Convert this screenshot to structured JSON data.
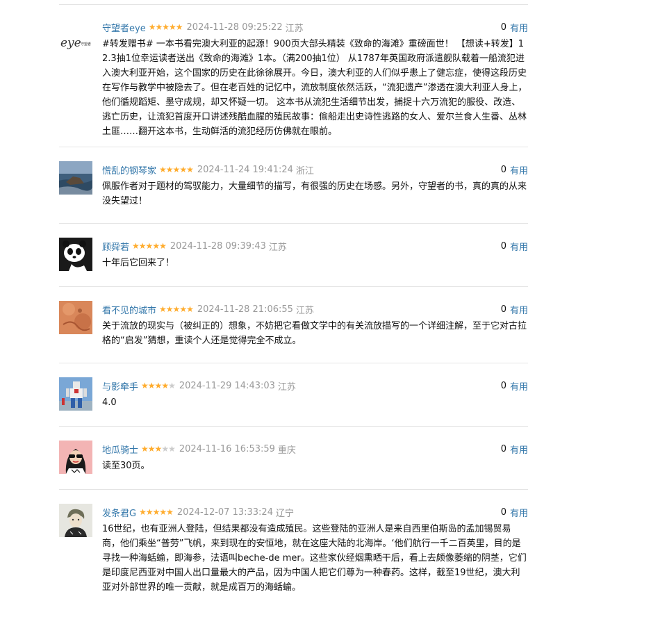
{
  "comments": [
    {
      "user": "守望者eye",
      "rating": 5,
      "time": "2024-11-28 09:25:22",
      "location": "江苏",
      "votes": "0",
      "useful_label": "有用",
      "avatar": "eye-logo-avatar",
      "avatar_text": "eye守望者",
      "text": "#转发赠书# 一本书看完澳大利亚的起源！900页大部头精装《致命的海滩》重磅面世！ 【想读+转发】12.3抽1位幸运读者送出《致命的海滩》1本。（满200抽1位） 从1787年英国政府派遣舰队载着一船流犯进入澳大利亚开始，这个国家的历史在此徐徐展开。今日，澳大利亚的人们似乎患上了健忘症，使得这段历史在写作与教学中被隐去了。但在老百姓的记忆中，流放制度依然活跃，“流犯遗产”渗透在澳大利亚人身上，他们循规蹈矩、墨守成规，却又怀疑一切。 这本书从流犯生活细节出发，捕捉十六万流犯的服役、改造、逃亡历史，让流犯首度开口讲述残酷血腥的殖民故事：偷船走出史诗性逃路的女人、爱尔兰食人生番、丛林土匪……翻开这本书，生动鲜活的流犯经历仿佛就在眼前。"
    },
    {
      "user": "慌乱的钢琴家",
      "rating": 5,
      "time": "2024-11-24 19:41:24",
      "location": "浙江",
      "votes": "0",
      "useful_label": "有用",
      "avatar": "seascape-avatar",
      "text": "佩服作者对于题材的驾驭能力，大量细节的描写，有很强的历史在场感。另外，守望者的书，真的真的从来没失望过！"
    },
    {
      "user": "顾舜若",
      "rating": 5,
      "time": "2024-11-28 09:39:43",
      "location": "江苏",
      "votes": "0",
      "useful_label": "有用",
      "avatar": "panda-avatar",
      "text": "十年后它回来了！"
    },
    {
      "user": "看不见的城市",
      "rating": 5,
      "time": "2024-11-28 21:06:55",
      "location": "江苏",
      "votes": "0",
      "useful_label": "有用",
      "avatar": "orange-texture-avatar",
      "text": "关于流放的现实与（被纠正的）想象，不妨把它看做文学中的有关流放描写的一个详细注解，至于它对古拉格的“启发”猜想，重读个人还是觉得完全不成立。"
    },
    {
      "user": "与影牵手",
      "rating": 4,
      "time": "2024-11-29 14:43:03",
      "location": "江苏",
      "votes": "0",
      "useful_label": "有用",
      "avatar": "robot-statue-avatar",
      "text": "4.0"
    },
    {
      "user": "地瓜骑士",
      "rating": 3,
      "time": "2024-11-16 16:53:59",
      "location": "重庆",
      "votes": "0",
      "useful_label": "有用",
      "avatar": "cartoon-girl-avatar",
      "text": "读至30页。"
    },
    {
      "user": "发条君G",
      "rating": 5,
      "time": "2024-12-07 13:33:24",
      "location": "辽宁",
      "votes": "0",
      "useful_label": "有用",
      "avatar": "sketch-portrait-avatar",
      "text": "16世纪，也有亚洲人登陆，但结果都没有造成殖民。这些登陆的亚洲人是来自西里伯斯岛的孟加锡贸易商，他们乘坐“普劳”飞帆，来到现在的安恒地，就在这座大陆的北海岸。‘他们航行一千二百英里，目的是寻找一种海蛞蝓，即海参，法语叫beche-de mer。这些家伙经烟熏晒干后，看上去颇像萎缩的阴茎，它们是印度尼西亚对中国人出口量最大的产品，因为中国人把它们尊为一种春药。这样，截至19世纪，澳大利亚对外部世界的唯一贡献，就是成百万的海蛞蝓。"
    }
  ],
  "colors": {
    "link": "#3377aa",
    "star": "#ffac2d",
    "meta": "#999999",
    "divider": "#e4e4e4"
  }
}
